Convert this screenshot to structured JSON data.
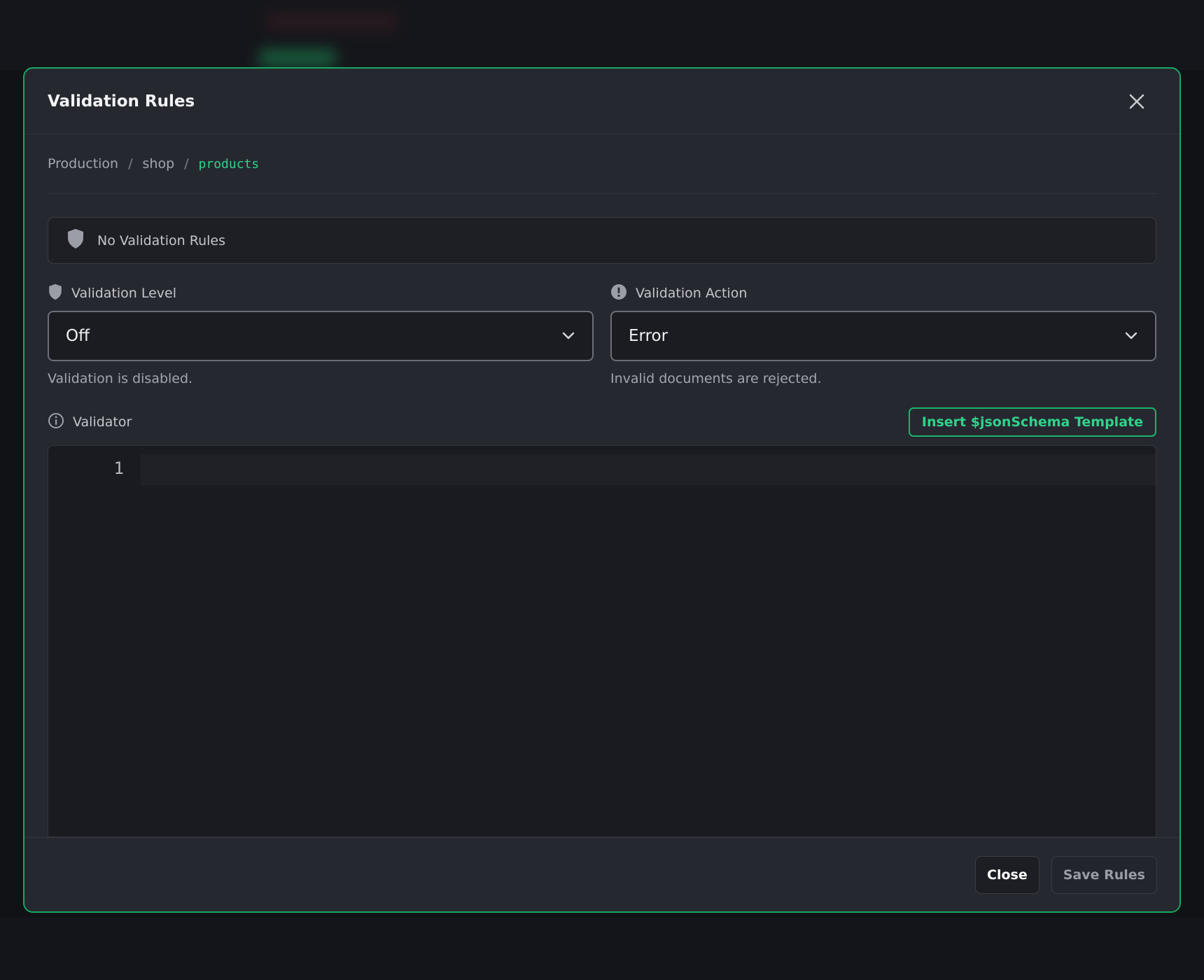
{
  "modal": {
    "title": "Validation Rules",
    "breadcrumb": {
      "connection": "Production",
      "database": "shop",
      "collection": "products",
      "separator": "/"
    },
    "notice": "No Validation Rules",
    "validation_level": {
      "label": "Validation Level",
      "value": "Off",
      "hint": "Validation is disabled."
    },
    "validation_action": {
      "label": "Validation Action",
      "value": "Error",
      "hint": "Invalid documents are rejected."
    },
    "validator": {
      "label": "Validator",
      "insert_template_label": "Insert $jsonSchema Template",
      "line_number": "1"
    },
    "footer": {
      "close_label": "Close",
      "save_label": "Save Rules"
    }
  },
  "icons": {
    "close": "close-icon",
    "shield": "shield-icon",
    "alert": "alert-icon",
    "info": "info-icon",
    "chevron": "chevron-down-icon"
  },
  "colors": {
    "accent": "#2fd38a",
    "modal_border": "#18a862",
    "modal_bg": "#262830",
    "editor_bg": "#1a1b20"
  }
}
